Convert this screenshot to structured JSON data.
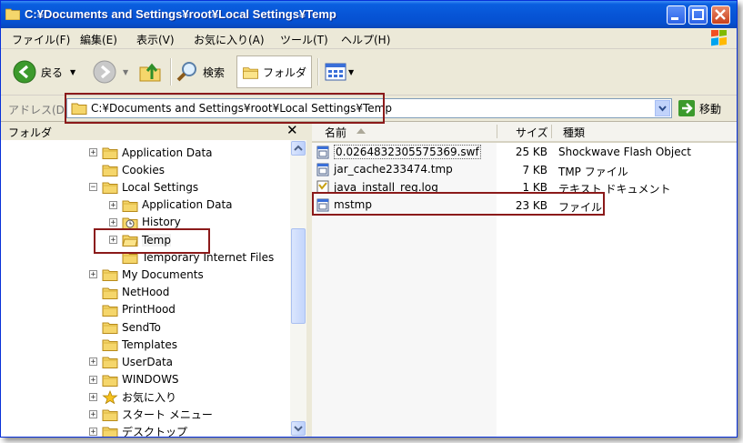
{
  "window": {
    "title": "C:¥Documents and Settings¥root¥Local Settings¥Temp"
  },
  "menu": {
    "items": [
      "ファイル(F)",
      "編集(E)",
      "表示(V)",
      "お気に入り(A)",
      "ツール(T)",
      "ヘルプ(H)"
    ]
  },
  "toolbar": {
    "back_label": "戻る",
    "search_label": "検索",
    "folders_label": "フォルダ"
  },
  "address": {
    "label": "アドレス(D)",
    "value": "C:¥Documents and Settings¥root¥Local Settings¥Temp",
    "go_label": "移動"
  },
  "folder_pane": {
    "title": "フォルダ",
    "close_glyph": "✕",
    "tree": [
      {
        "label": "Application Data",
        "level": 0,
        "expander": "+"
      },
      {
        "label": "Cookies",
        "level": 0,
        "expander": ""
      },
      {
        "label": "Local Settings",
        "level": 0,
        "expander": "−"
      },
      {
        "label": "Application Data",
        "level": 1,
        "expander": "+"
      },
      {
        "label": "History",
        "level": 1,
        "expander": "+",
        "icon": "history"
      },
      {
        "label": "Temp",
        "level": 1,
        "expander": "+",
        "selected": true
      },
      {
        "label": "Temporary Internet Files",
        "level": 1,
        "expander": ""
      },
      {
        "label": "My Documents",
        "level": 0,
        "expander": "+"
      },
      {
        "label": "NetHood",
        "level": 0,
        "expander": ""
      },
      {
        "label": "PrintHood",
        "level": 0,
        "expander": ""
      },
      {
        "label": "SendTo",
        "level": 0,
        "expander": ""
      },
      {
        "label": "Templates",
        "level": 0,
        "expander": ""
      },
      {
        "label": "UserData",
        "level": 0,
        "expander": "+"
      },
      {
        "label": "WINDOWS",
        "level": 0,
        "expander": "+"
      },
      {
        "label": "お気に入り",
        "level": 0,
        "expander": "+",
        "icon": "star"
      },
      {
        "label": "スタート メニュー",
        "level": 0,
        "expander": "+"
      },
      {
        "label": "デスクトップ",
        "level": 0,
        "expander": "+"
      }
    ]
  },
  "file_list": {
    "columns": {
      "name": "名前",
      "size": "サイズ",
      "type": "種類"
    },
    "rows": [
      {
        "name": "0.0264832305575369.swf",
        "size": "25 KB",
        "type": "Shockwave Flash Object",
        "icon": "swf"
      },
      {
        "name": "jar_cache233474.tmp",
        "size": "7 KB",
        "type": "TMP ファイル",
        "icon": "file"
      },
      {
        "name": "java_install_reg.log",
        "size": "1 KB",
        "type": "テキスト ドキュメント",
        "icon": "log"
      },
      {
        "name": "mstmp",
        "size": "23 KB",
        "type": "ファイル",
        "icon": "file"
      }
    ]
  },
  "colors": {
    "titlebar": "#0755d6",
    "highlight": "#8b1a1a",
    "chrome": "#ece9d8"
  }
}
